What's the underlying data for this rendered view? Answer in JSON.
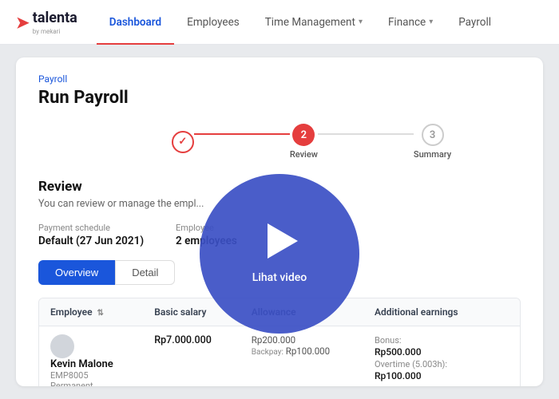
{
  "nav": {
    "logo_text": "talenta",
    "logo_sub": "by mekari",
    "items": [
      {
        "label": "Dashboard",
        "active": true,
        "has_dropdown": false
      },
      {
        "label": "Employees",
        "active": false,
        "has_dropdown": false
      },
      {
        "label": "Time Management",
        "active": false,
        "has_dropdown": true
      },
      {
        "label": "Finance",
        "active": false,
        "has_dropdown": true
      },
      {
        "label": "Payroll",
        "active": false,
        "has_dropdown": false
      }
    ]
  },
  "breadcrumb": "Payroll",
  "page_title": "Run Payroll",
  "stepper": {
    "steps": [
      {
        "id": 1,
        "state": "completed",
        "label": ""
      },
      {
        "id": 2,
        "state": "active",
        "label": "Review"
      },
      {
        "id": 3,
        "state": "inactive",
        "label": "Summary"
      }
    ]
  },
  "review": {
    "title": "Review",
    "description": "You can review or manage the empl..."
  },
  "info": {
    "payment_schedule_label": "Payment schedule",
    "payment_schedule_value": "Default (27 Jun 2021)",
    "employee_label": "Employee",
    "employee_value": "2 employees"
  },
  "tabs": [
    {
      "label": "Overview",
      "active": true
    },
    {
      "label": "Detail",
      "active": false
    }
  ],
  "table": {
    "columns": [
      {
        "label": "Employee",
        "sortable": true
      },
      {
        "label": "Basic salary",
        "sortable": false
      },
      {
        "label": "Allowance",
        "sortable": false
      },
      {
        "label": "Additional earnings",
        "sortable": false
      },
      {
        "label": "",
        "sortable": false
      }
    ],
    "rows": [
      {
        "name": "Kevin Malone",
        "emp_id": "EMP8005",
        "emp_type": "Permanent",
        "basic_salary": "Rp7.000.000",
        "allowance_lines": [
          {
            "label": "",
            "value": "Rp200.000"
          },
          {
            "label": "Backpay:",
            "value": "Rp100.000"
          }
        ],
        "earnings": [
          {
            "label": "Bonus:",
            "value": "Rp500.000"
          },
          {
            "label": "Overtime (5.003h):",
            "value": "Rp100.000"
          }
        ]
      }
    ]
  },
  "video_overlay": {
    "label": "Lihat video"
  }
}
